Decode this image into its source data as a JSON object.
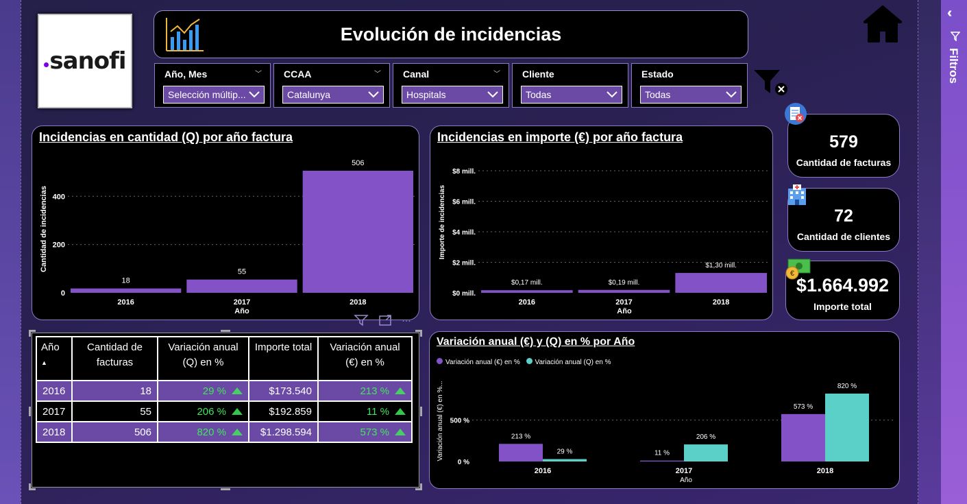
{
  "header": {
    "title": "Evolución de incidencias",
    "logo": "sanofi"
  },
  "pane": {
    "label": "Filtros"
  },
  "slicers": [
    {
      "label": "Año, Mes",
      "value": "Selección múltip..."
    },
    {
      "label": "CCAA",
      "value": "Catalunya"
    },
    {
      "label": "Canal",
      "value": "Hospitals"
    },
    {
      "label": "Cliente",
      "value": "Todas"
    },
    {
      "label": "Estado",
      "value": "Todas"
    }
  ],
  "kpis": [
    {
      "value": "579",
      "label": "Cantidad de facturas",
      "icon": "invoice-icon"
    },
    {
      "value": "72",
      "label": "Cantidad de clientes",
      "icon": "hospital-icon"
    },
    {
      "value": "$1.664.992",
      "label": "Importe total",
      "icon": "money-icon"
    }
  ],
  "colors": {
    "purple": "#8352c7",
    "teal": "#5bd0c8",
    "green": "#41e65a"
  },
  "chart_data": [
    {
      "type": "bar",
      "title": "Incidencias en cantidad (Q) por año factura",
      "xlabel": "Año",
      "ylabel": "Cantidad de incidencias",
      "categories": [
        "2016",
        "2017",
        "2018"
      ],
      "values": [
        18,
        55,
        506
      ],
      "labels": [
        "18",
        "55",
        "506"
      ],
      "yticks": [
        "0",
        "200",
        "400"
      ],
      "ylim": [
        0,
        506
      ]
    },
    {
      "type": "bar",
      "title": "Incidencias en importe (€) por año factura",
      "xlabel": "Año",
      "ylabel": "Importe de incidencias",
      "categories": [
        "2016",
        "2017",
        "2018"
      ],
      "values": [
        0.17,
        0.19,
        1.3
      ],
      "labels": [
        "$0,17 mill.",
        "$0,19 mill.",
        "$1,30 mill."
      ],
      "yticks": [
        "$0 mill.",
        "$2 mill.",
        "$4 mill.",
        "$6 mill.",
        "$8 mill."
      ],
      "ylim": [
        0,
        8
      ]
    },
    {
      "type": "bar",
      "title": "Variación anual (€) y (Q) en % por Año",
      "xlabel": "Año",
      "ylabel": "Variación anual (€) en %...",
      "categories": [
        "2016",
        "2017",
        "2018"
      ],
      "yticks": [
        "0 %",
        "500 %"
      ],
      "ylim": [
        0,
        820
      ],
      "series": [
        {
          "name": "Variación anual (€) en %",
          "values": [
            213,
            11,
            573
          ],
          "labels": [
            "213 %",
            "11 %",
            "573 %"
          ]
        },
        {
          "name": "Variación anual (Q) en %",
          "values": [
            29,
            206,
            820
          ],
          "labels": [
            "29 %",
            "206 %",
            "820 %"
          ]
        }
      ]
    }
  ],
  "table": {
    "headers": [
      "Año",
      "Cantidad de facturas",
      "Variación anual (Q) en %",
      "Importe total",
      "Variación anual (€) en %"
    ],
    "rows": [
      {
        "year": "2016",
        "count": "18",
        "varq": "29 %",
        "importe": "$173.540",
        "vare": "213 %"
      },
      {
        "year": "2017",
        "count": "55",
        "varq": "206 %",
        "importe": "$192.859",
        "vare": "11 %"
      },
      {
        "year": "2018",
        "count": "506",
        "varq": "820 %",
        "importe": "$1.298.594",
        "vare": "573 %"
      }
    ]
  }
}
